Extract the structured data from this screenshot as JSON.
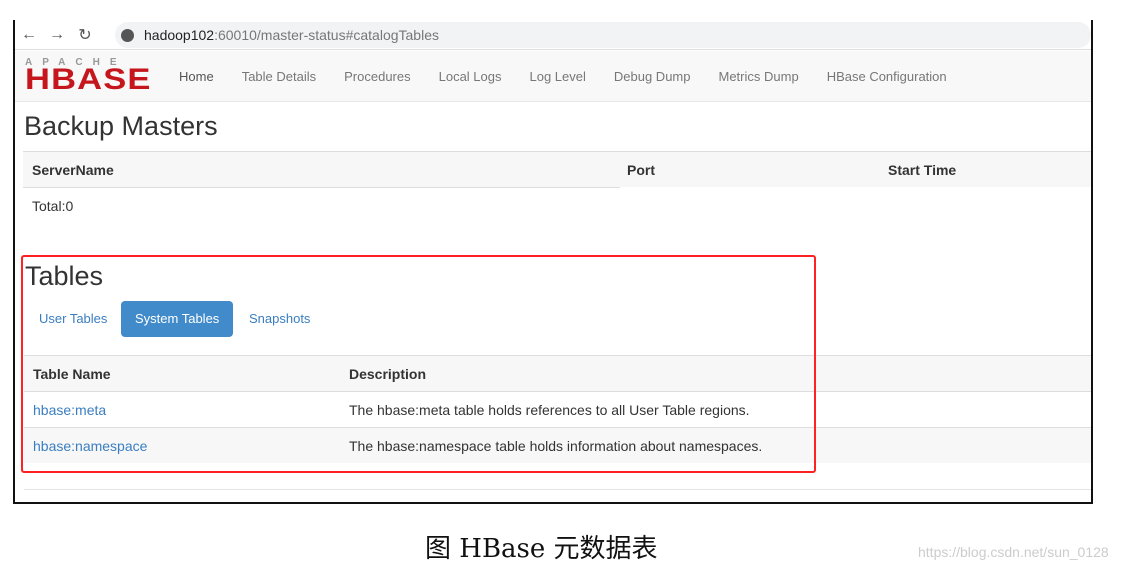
{
  "browser": {
    "url_host": "hadoop102",
    "url_rest": ":60010/master-status#catalogTables"
  },
  "logo": {
    "top": "APACHE",
    "main": "HBASE"
  },
  "nav": [
    "Home",
    "Table Details",
    "Procedures",
    "Local Logs",
    "Log Level",
    "Debug Dump",
    "Metrics Dump",
    "HBase Configuration"
  ],
  "backup": {
    "title": "Backup Masters",
    "columns": [
      "ServerName",
      "Port",
      "Start Time"
    ],
    "total": "Total:0"
  },
  "tables": {
    "title": "Tables",
    "tabs": [
      "User Tables",
      "System Tables",
      "Snapshots"
    ],
    "active_tab": "System Tables",
    "columns": [
      "Table Name",
      "Description"
    ],
    "rows": [
      {
        "name": "hbase:meta",
        "desc": "The hbase:meta table holds references to all User Table regions."
      },
      {
        "name": "hbase:namespace",
        "desc": "The hbase:namespace table holds information about namespaces."
      }
    ]
  },
  "caption": "图 HBase 元数据表",
  "watermark": "https://blog.csdn.net/sun_0128",
  "colors": {
    "highlight": "#ff2222",
    "brand": "#c4161c",
    "link": "#3a7ec1",
    "active_tab": "#428bca"
  }
}
